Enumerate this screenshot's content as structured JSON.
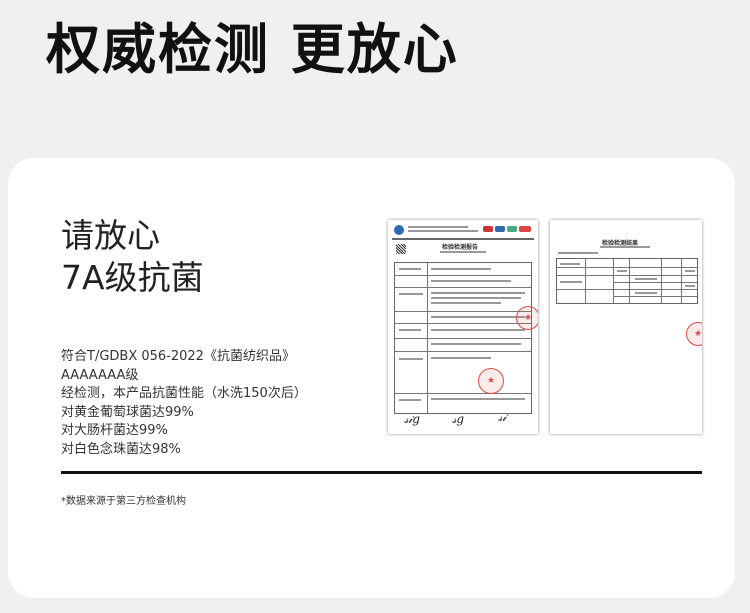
{
  "headline": "权威检测 更放心",
  "card": {
    "title_line1": "请放心",
    "title_line2": "7A级抗菌",
    "specs": [
      "符合T/GDBX 056-2022《抗菌纺织品》",
      "AAAAAAA级",
      "经检测，本产品抗菌性能（水洗150次后）",
      "对黄金葡萄球菌达99%",
      "对大肠杆菌达99%",
      "对白色念珠菌达98%"
    ],
    "footnote": "*数据来源于第三方检查机构"
  },
  "reports": {
    "report1_title": "检验检测报告",
    "report2_title": "检验检测结果"
  },
  "colors": {
    "page_bg": "#f0f0f0",
    "card_bg": "#ffffff",
    "stamp_red": "#e04a4a"
  }
}
